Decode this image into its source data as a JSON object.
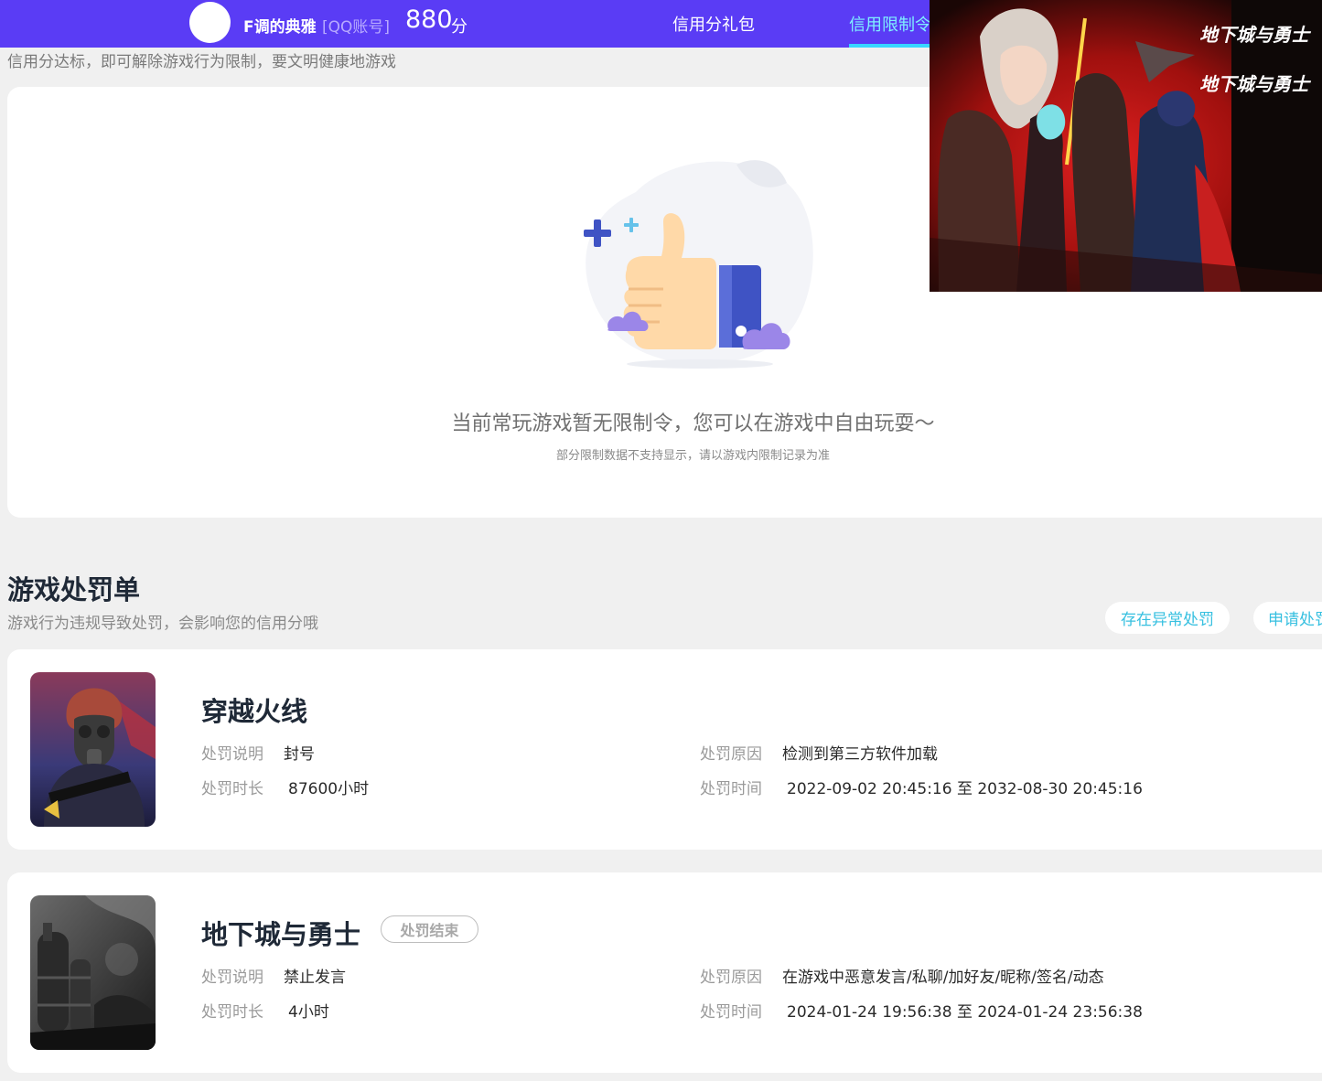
{
  "header": {
    "username": "F调的典雅",
    "account_tag": "[QQ账号]",
    "score": "880",
    "score_unit": "分",
    "nav": {
      "gift": "信用分礼包",
      "limit": "信用限制令"
    },
    "colors": {
      "bar": "#5a3cf5",
      "active": "#7ff0ff"
    }
  },
  "limit_section": {
    "subtitle": "信用分达标，即可解除游戏行为限制，要文明健康地游戏",
    "empty_message": "当前常玩游戏暂无限制令，您可以在游戏中自由玩耍～",
    "empty_note": "部分限制数据不支持显示，请以游戏内限制记录为准",
    "illustration": "thumbs-up-icon"
  },
  "banner": {
    "logo_text_1": "地下城与勇士",
    "logo_text_2": "地下城与勇士"
  },
  "punishment": {
    "title": "游戏处罚单",
    "subtitle": "游戏行为违规导致处罚，会影响您的信用分哦",
    "buttons": {
      "abnormal": "存在异常处罚",
      "apply": "申请处罚"
    },
    "labels": {
      "desc": "处罚说明",
      "reason": "处罚原因",
      "duration": "处罚时长",
      "time": "处罚时间"
    },
    "items": [
      {
        "game": "穿越火线",
        "status": "",
        "desc": "封号",
        "reason": "检测到第三方软件加载",
        "duration": "87600小时",
        "time": "2022-09-02 20:45:16 至 2032-08-30 20:45:16"
      },
      {
        "game": "地下城与勇士",
        "status": "处罚结束",
        "desc": "禁止发言",
        "reason": "在游戏中恶意发言/私聊/加好友/昵称/签名/动态",
        "duration": "4小时",
        "time": "2024-01-24 19:56:38 至 2024-01-24 23:56:38"
      }
    ]
  }
}
